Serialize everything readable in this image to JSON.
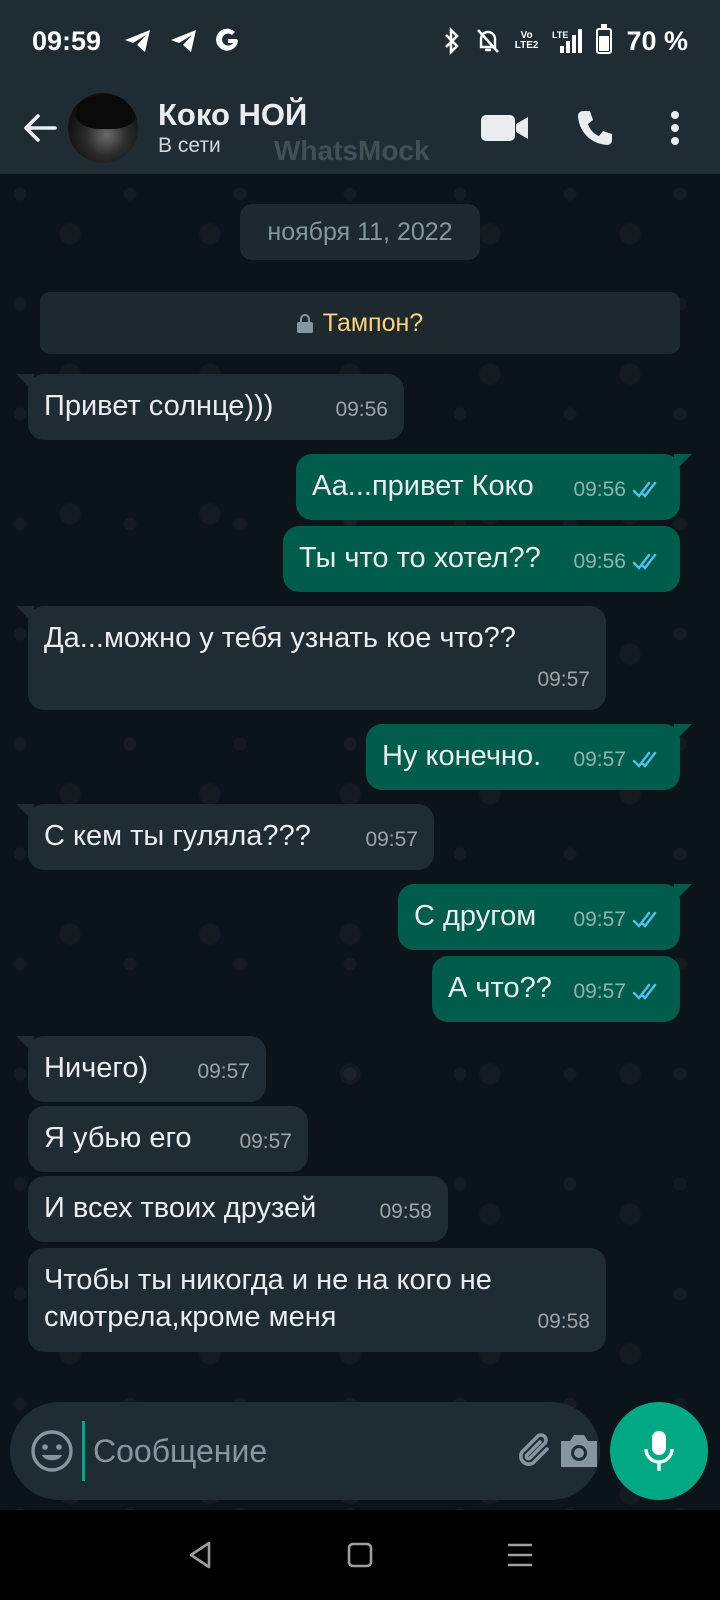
{
  "status_bar": {
    "time": "09:59",
    "battery": "70 %",
    "battery_level": 0.7,
    "volte_top": "Vo",
    "volte_bottom": "LTE2",
    "lte": "LTE"
  },
  "header": {
    "contact_name": "Коко НОЙ",
    "contact_status": "В сети",
    "watermark": "WhatsMock"
  },
  "chat": {
    "date": "ноября 11, 2022",
    "notice": "Тампон?",
    "messages": [
      {
        "dir": "in",
        "text": "Привет солнце)))",
        "time": "09:56"
      },
      {
        "dir": "out",
        "text": "Аа...привет Коко",
        "time": "09:56"
      },
      {
        "dir": "out",
        "text": "Ты что то хотел??",
        "time": "09:56"
      },
      {
        "dir": "in",
        "text": "Да...можно у тебя узнать кое что??",
        "time": "09:57"
      },
      {
        "dir": "out",
        "text": "Ну конечно.",
        "time": "09:57"
      },
      {
        "dir": "in",
        "text": "С кем ты гуляла???",
        "time": "09:57"
      },
      {
        "dir": "out",
        "text": "С другом",
        "time": "09:57"
      },
      {
        "dir": "out",
        "text": "А что??",
        "time": "09:57"
      },
      {
        "dir": "in",
        "text": "Ничего)",
        "time": "09:57"
      },
      {
        "dir": "in",
        "text": "Я убью его",
        "time": "09:57"
      },
      {
        "dir": "in",
        "text": "И всех твоих друзей",
        "time": "09:58"
      },
      {
        "dir": "in",
        "text": "Чтобы ты никогда и не на кого не\nсмотрела,кроме меня",
        "time": "09:58"
      }
    ]
  },
  "input": {
    "placeholder": "Сообщение"
  },
  "colors": {
    "incoming": "#202c33",
    "outgoing": "#005c4b",
    "accent": "#00a884",
    "read_ticks": "#53bdeb",
    "notice_text": "#ffd279"
  },
  "icons": [
    "back-arrow-icon",
    "video-call-icon",
    "phone-icon",
    "more-vert-icon",
    "lock-icon",
    "double-check-icon",
    "emoji-icon",
    "attach-icon",
    "camera-icon",
    "mic-icon",
    "nav-back-icon",
    "nav-home-icon",
    "nav-recents-icon"
  ]
}
